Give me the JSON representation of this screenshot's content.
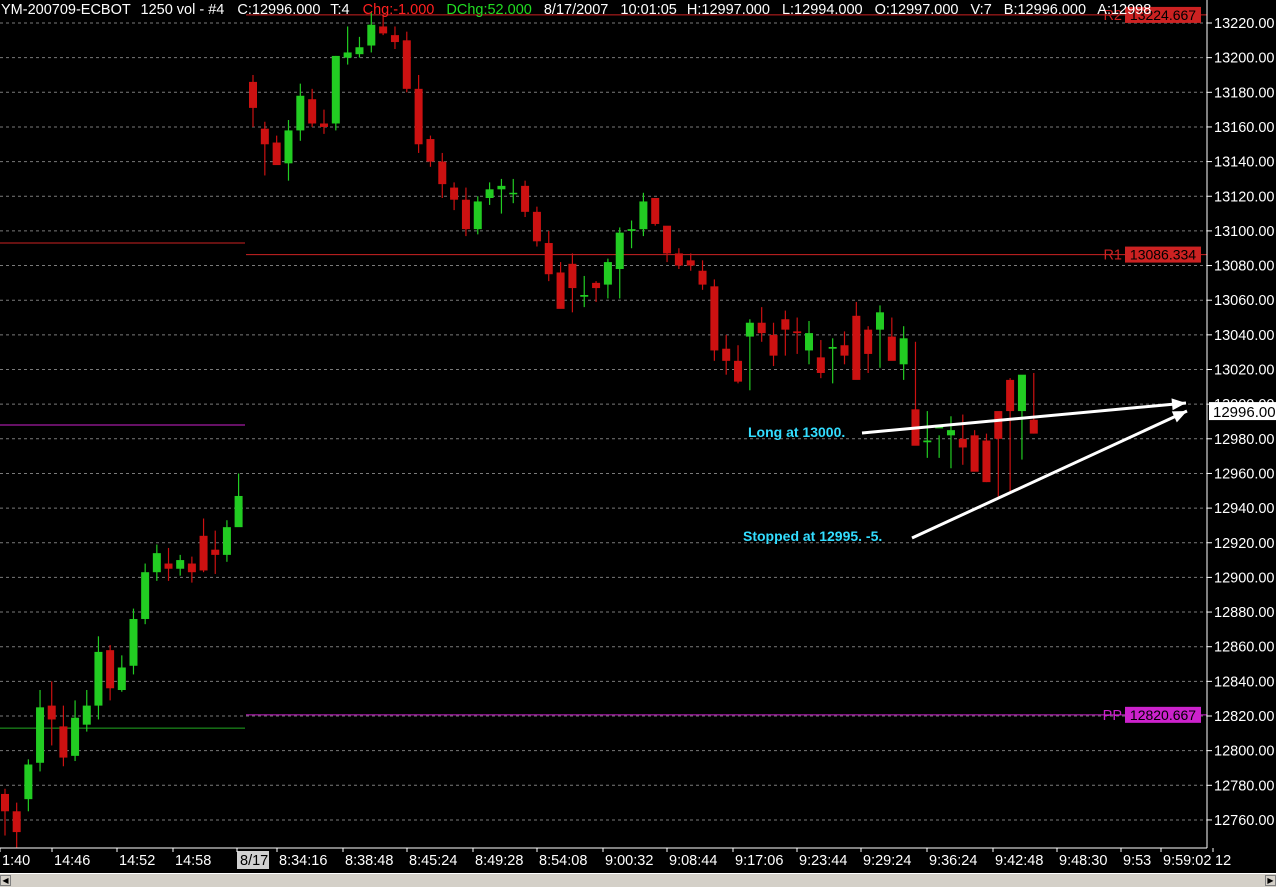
{
  "header": {
    "symbol": "YM-200709-ECBOT",
    "interval": "1250 vol - #4",
    "close": "C:12996.000",
    "ticks": "T:4",
    "chg": "Chg:-1.000",
    "dchg": "DChg:52.000",
    "date": "8/17/2007",
    "time": "10:01:05",
    "high": "H:12997.000",
    "low": "L:12994.000",
    "open": "O:12997.000",
    "volume": "V:7",
    "bid": "B:12996.000",
    "ask": "A:12998"
  },
  "colors": {
    "background": "#000000",
    "up_candle": "#22cc22",
    "down_candle": "#cc1111",
    "grid": "#7a7a7a",
    "r_line": "#cc2222",
    "pp_line": "#cc22cc",
    "s_line": "#22aa22",
    "last_price_bg": "#ffffff",
    "annotation_text": "#33ddff",
    "arrow": "#ffffff"
  },
  "chart_data": {
    "type": "candlestick",
    "ylim": [
      12745,
      13227
    ],
    "y_ticks": [
      "13220.00",
      "13200.00",
      "13180.00",
      "13160.00",
      "13140.00",
      "13120.00",
      "13100.00",
      "13080.00",
      "13060.00",
      "13040.00",
      "13020.00",
      "13000.00",
      "12980.00",
      "12960.00",
      "12940.00",
      "12920.00",
      "12900.00",
      "12880.00",
      "12860.00",
      "12840.00",
      "12820.00",
      "12800.00",
      "12780.00",
      "12760.00"
    ],
    "x_labels": [
      "1:40",
      "14:46",
      "14:52",
      "14:58",
      "8/17",
      "8:34:16",
      "8:38:48",
      "8:45:24",
      "8:49:28",
      "8:54:08",
      "9:00:32",
      "9:08:44",
      "9:17:06",
      "9:23:44",
      "9:29:24",
      "9:36:24",
      "9:42:48",
      "9:48:30",
      "9:53",
      "9:59:02",
      "12"
    ],
    "last_price": "12996.00",
    "levels": [
      {
        "name": "R2",
        "value": 13224.667,
        "label": "13224.667"
      },
      {
        "name": "R1",
        "value": 13086.334,
        "label": "13086.334"
      },
      {
        "name": "PP",
        "value": 12820.667,
        "label": "12820.667"
      }
    ],
    "prior_session_levels": [
      {
        "name": "R1",
        "value": 13093
      },
      {
        "name": "PP",
        "value": 12988
      },
      {
        "name": "S1",
        "value": 12813
      }
    ],
    "session_1": {
      "o": [
        12775,
        12765,
        12772,
        12793,
        12826,
        12814,
        12797,
        12815,
        12826,
        12858,
        12835,
        12849,
        12876,
        12903,
        12908,
        12905,
        12908,
        12924,
        12916,
        12913,
        12929
      ],
      "c": [
        12765,
        12753,
        12792,
        12825,
        12818,
        12796,
        12819,
        12826,
        12857,
        12836,
        12848,
        12876,
        12903,
        12914,
        12905,
        12910,
        12903,
        12904,
        12913,
        12929,
        12947
      ],
      "h": [
        12778,
        12770,
        12795,
        12835,
        12840,
        12826,
        12829,
        12835,
        12866,
        12861,
        12855,
        12882,
        12908,
        12919,
        12917,
        12913,
        12912,
        12934,
        12927,
        12933,
        12960
      ],
      "l": [
        12751,
        12744,
        12765,
        12788,
        12803,
        12791,
        12794,
        12811,
        12818,
        12829,
        12834,
        12844,
        12873,
        12898,
        12898,
        12901,
        12897,
        12903,
        12902,
        12909,
        12930
      ]
    },
    "session_2": {
      "o": [
        13186,
        13159,
        13151,
        13139,
        13158,
        13176,
        13162,
        13162,
        13200,
        13202,
        13207,
        13218,
        13213,
        13210,
        13182,
        13153,
        13140,
        13125,
        13118,
        13101,
        13119,
        13124,
        13122,
        13126,
        13111,
        13093,
        13076,
        13081,
        13062,
        13070,
        13069,
        13078,
        13100,
        13101,
        13119,
        13103,
        13087,
        13083,
        13077,
        13068,
        13032,
        13025,
        13039,
        13047,
        13040,
        13049,
        13042,
        13031,
        13027,
        13032,
        13034,
        13051,
        13043,
        13043,
        13039,
        13023,
        12997,
        12978,
        12986,
        12982,
        12980,
        12982,
        12979,
        12996,
        13014,
        12996,
        12991
      ],
      "c": [
        13171,
        13150,
        13138,
        13158,
        13178,
        13162,
        13160,
        13201,
        13203,
        13206,
        13219,
        13214,
        13209,
        13182,
        13150,
        13140,
        13127,
        13118,
        13101,
        13117,
        13124,
        13126,
        13122,
        13111,
        13094,
        13075,
        13055,
        13067,
        13063,
        13067,
        13082,
        13099,
        13101,
        13117,
        13104,
        13087,
        13080,
        13080,
        13069,
        13031,
        13025,
        13013,
        13047,
        13041,
        13028,
        13043,
        13041,
        13041,
        13018,
        13033,
        13028,
        13014,
        13029,
        13053,
        13025,
        13038,
        12976,
        12979,
        12988,
        12985,
        12975,
        12961,
        12955,
        12980,
        12996,
        13017,
        12983,
        12994,
        12998,
        12996
      ],
      "h": [
        13190,
        13163,
        13155,
        13164,
        13185,
        13182,
        13170,
        13201,
        13218,
        13212,
        13226,
        13225,
        13218,
        13215,
        13190,
        13155,
        13145,
        13128,
        13125,
        13120,
        13128,
        13130,
        13130,
        13129,
        13114,
        13100,
        13082,
        13087,
        13074,
        13071,
        13084,
        13102,
        13106,
        13122,
        13118,
        13102,
        13090,
        13087,
        13083,
        13072,
        13040,
        13034,
        13049,
        13056,
        13047,
        13054,
        13050,
        13048,
        13037,
        13038,
        13042,
        13059,
        13045,
        13057,
        13050,
        13045,
        13036,
        12996,
        12982,
        12993,
        12994,
        12985,
        12983,
        12990,
        13015,
        13015,
        13018,
        13003,
        13006,
        12998
      ],
      "l": [
        13160,
        13132,
        13142,
        13129,
        13152,
        13160,
        13156,
        13158,
        13196,
        13200,
        13203,
        13213,
        13205,
        13180,
        13145,
        13137,
        13119,
        13112,
        13097,
        13098,
        13115,
        13110,
        13116,
        13108,
        13091,
        13071,
        13057,
        13053,
        13056,
        13059,
        13061,
        13061,
        13090,
        13097,
        13103,
        13082,
        13078,
        13077,
        13066,
        13025,
        13017,
        13012,
        13008,
        13036,
        13022,
        13028,
        13029,
        13023,
        13015,
        13012,
        13023,
        13033,
        13018,
        13021,
        13026,
        13014,
        12985,
        12969,
        12969,
        12963,
        12965,
        12975,
        12955,
        12946,
        12949,
        12968,
        12983,
        12986,
        12986,
        12992
      ]
    }
  },
  "annotations": {
    "long": "Long at 13000.",
    "stopped": "Stopped at 12995.  -5."
  },
  "scrollbar": {
    "left_icon": "left-arrow-icon",
    "right_icon": "right-arrow-icon"
  }
}
